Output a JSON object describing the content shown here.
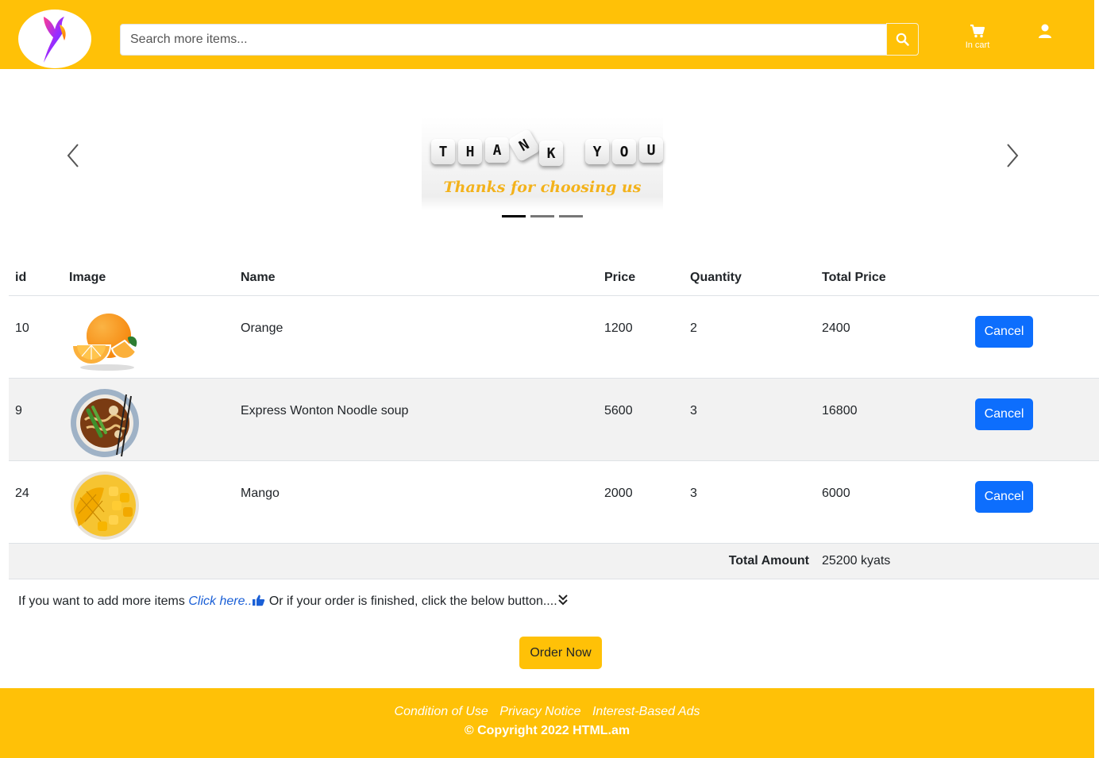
{
  "header": {
    "search_placeholder": "Search more items...",
    "cart_label": "In cart",
    "brand_color": "#ffc107"
  },
  "carousel": {
    "slide_letters": [
      "T",
      "H",
      "A",
      "N",
      "K",
      "Y",
      "O",
      "U"
    ],
    "slide_caption": "Thanks for choosing us",
    "slide_count": 3,
    "active_index": 0
  },
  "table": {
    "columns": [
      "id",
      "Image",
      "Name",
      "Price",
      "Quantity",
      "Total Price"
    ],
    "rows": [
      {
        "id": "10",
        "image": "orange",
        "name": "Orange",
        "price": "1200",
        "quantity": "2",
        "total": "2400",
        "action": "Cancel"
      },
      {
        "id": "9",
        "image": "noodle-soup",
        "name": "Express Wonton Noodle soup",
        "price": "5600",
        "quantity": "3",
        "total": "16800",
        "action": "Cancel"
      },
      {
        "id": "24",
        "image": "mango",
        "name": "Mango",
        "price": "2000",
        "quantity": "3",
        "total": "6000",
        "action": "Cancel"
      }
    ],
    "total_label": "Total Amount",
    "total_value": "25200 kyats"
  },
  "notice": {
    "prefix": "If you want to add more items",
    "link": "Click here..",
    "suffix": "Or if your order is finished, click the below button...."
  },
  "order_button": "Order Now",
  "footer": {
    "links": [
      "Condition of Use",
      "Privacy Notice",
      "Interest-Based Ads"
    ],
    "copyright": "© Copyright 2022 HTML.am"
  },
  "colors": {
    "accent": "#ffc107",
    "primary_button": "#0d6efd",
    "link": "#1a5fd6"
  }
}
